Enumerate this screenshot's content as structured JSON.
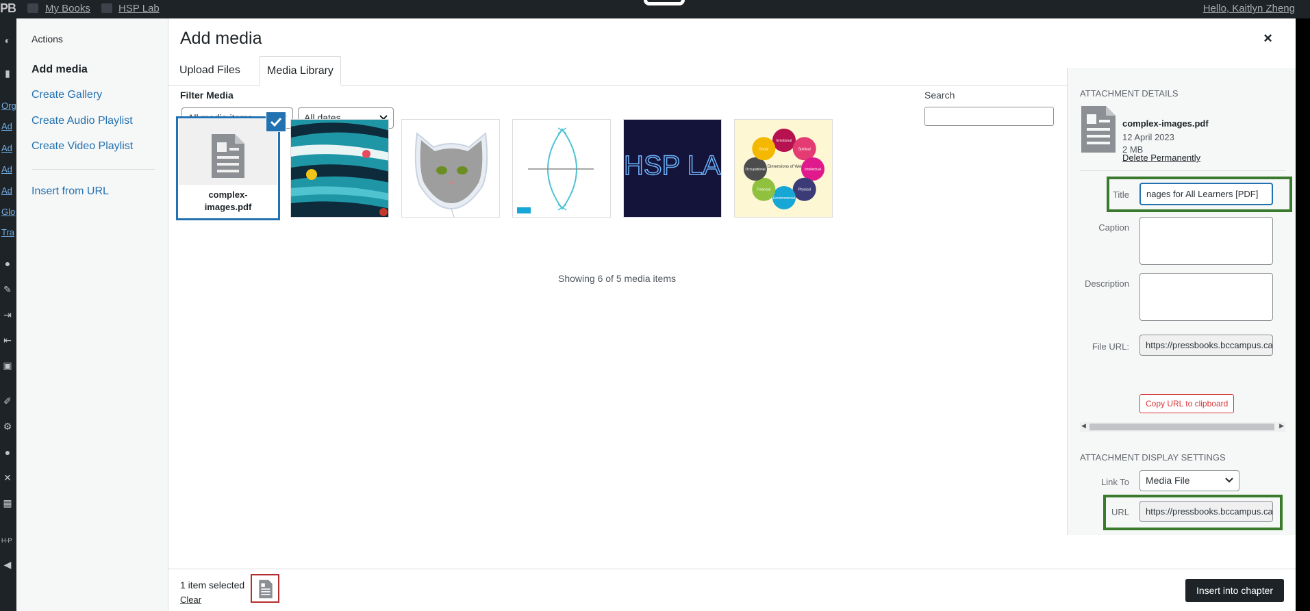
{
  "adminbar": {
    "logo": "PB",
    "my_books": "My Books",
    "site": "HSP Lab",
    "greeting": "Hello, Kaitlyn Zheng"
  },
  "adminside": {
    "links": [
      "Org",
      "Ad",
      "Ad",
      "Ad",
      "Ad",
      "Glo",
      "Tra"
    ],
    "letters": "H-P"
  },
  "sidebar": {
    "heading": "Actions",
    "items": [
      {
        "label": "Add media"
      },
      {
        "label": "Create Gallery"
      },
      {
        "label": "Create Audio Playlist"
      },
      {
        "label": "Create Video Playlist"
      },
      {
        "label": "Insert from URL"
      }
    ]
  },
  "header": {
    "title": "Add media",
    "close": "×"
  },
  "tabs": [
    {
      "label": "Upload Files"
    },
    {
      "label": "Media Library"
    }
  ],
  "filters": {
    "label": "Filter Media",
    "type_selected": "All media items",
    "date_selected": "All dates",
    "search_label": "Search"
  },
  "attachments": [
    {
      "name": "complex-images.pdf",
      "name_line1": "complex-",
      "name_line2": "images.pdf",
      "kind": "document-icon",
      "selected": true
    },
    {
      "name": "infographic",
      "kind": "image"
    },
    {
      "name": "cat balloon",
      "kind": "image"
    },
    {
      "name": "diagram",
      "kind": "image"
    },
    {
      "name": "HSP LAB logo",
      "kind": "image",
      "text": "HSP LAB"
    },
    {
      "name": "Eight Dimensions of Wellness",
      "kind": "image",
      "center": "Eight Dimensions of Wellness",
      "labels": [
        "Emotional",
        "Spiritual",
        "Intellectual",
        "Physical",
        "Environmental",
        "Financial",
        "Occupational",
        "Social"
      ],
      "colors": [
        "#b5124f",
        "#e33b72",
        "#e01a8d",
        "#3b3b78",
        "#17a7d6",
        "#8fc13f",
        "#4d4d4d",
        "#f5b800"
      ]
    }
  ],
  "showing": "Showing 6 of 5 media items",
  "details": {
    "section_title": "Attachment Details",
    "filename": "complex-images.pdf",
    "date": "12 April 2023",
    "size": "2 MB",
    "delete": "Delete Permanently",
    "title_label": "Title",
    "title_value": "nages for All Learners [PDF]",
    "caption_label": "Caption",
    "description_label": "Description",
    "file_url_label": "File URL:",
    "file_url_value": "https://pressbooks.bccampus.ca",
    "copy_label": "Copy URL to clipboard",
    "display_title": "Attachment Display Settings",
    "link_to_label": "Link To",
    "link_to_value": "Media File",
    "url_label": "URL",
    "url_value": "https://pressbooks.bccampus.ca"
  },
  "toolbar": {
    "selected": "1 item selected",
    "clear": "Clear",
    "insert": "Insert into chapter"
  },
  "colors": {
    "accent": "#2271b1",
    "highlight": "#3a7a2d",
    "danger": "#d63638"
  }
}
